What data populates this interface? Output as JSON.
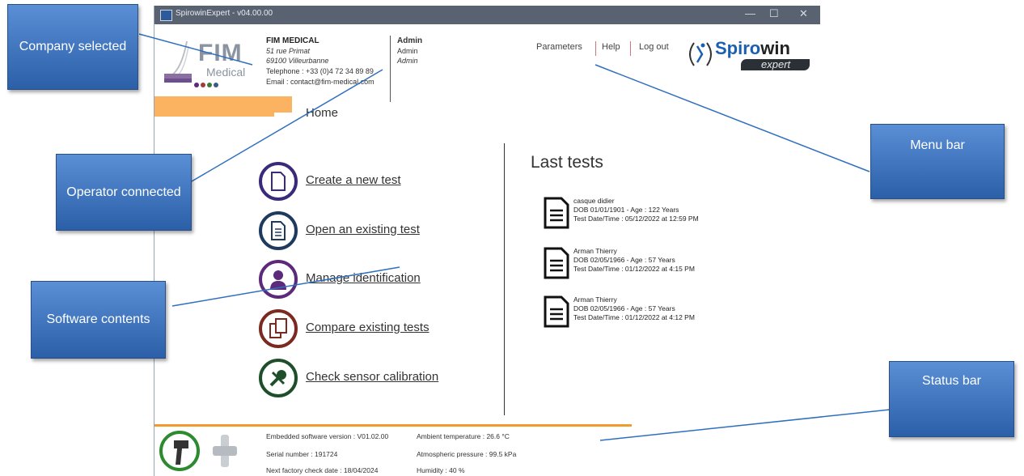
{
  "window": {
    "title": "SpirowinExpert - v04.00.00",
    "controls": [
      "—",
      "☐",
      "✕"
    ]
  },
  "company": {
    "logo_text": "FIM",
    "logo_sub": "Medical",
    "name": "FIM MEDICAL",
    "address1": "51 rue Primat",
    "address2": "69100 Villeurbanne",
    "phone": "Telephone : +33 (0)4 72 34 89 89",
    "email": "Email : contact@fim-medical.com"
  },
  "operator": {
    "title": "Admin",
    "line1": "Admin",
    "line2": "Admin"
  },
  "menu": {
    "parameters": "Parameters",
    "help": "Help",
    "logout": "Log out"
  },
  "brand": {
    "name_a": "Spiro",
    "name_b": "win",
    "sub": "expert"
  },
  "home_tab": "Home",
  "actions": [
    {
      "label": "Create a new test",
      "icon": "new-document-icon",
      "color": "#3b2a78"
    },
    {
      "label": "Open an existing test",
      "icon": "open-document-icon",
      "color": "#1e3a5f"
    },
    {
      "label": "Manage identification",
      "icon": "person-icon",
      "color": "#5b2a7a"
    },
    {
      "label": "Compare existing tests",
      "icon": "compare-icon",
      "color": "#7a2a20"
    },
    {
      "label": "Check sensor calibration",
      "icon": "wrench-icon",
      "color": "#1f4f2a"
    }
  ],
  "last_tests": {
    "title": "Last tests",
    "items": [
      {
        "name": "casque didier",
        "dob": "DOB 01/01/1901 - Age : 122 Years",
        "date": "Test Date/Time : 05/12/2022 at 12:59 PM"
      },
      {
        "name": "Arman Thierry",
        "dob": "DOB 02/05/1966 - Age : 57 Years",
        "date": "Test Date/Time : 01/12/2022 at 4:15 PM"
      },
      {
        "name": "Arman Thierry",
        "dob": "DOB 02/05/1966 - Age : 57 Years",
        "date": "Test Date/Time : 01/12/2022 at 4:12 PM"
      }
    ]
  },
  "status": {
    "embedded": "Embedded software version : V01.02.00",
    "serial": "Serial number : 191724",
    "next_check": "Next factory check date  : 18/04/2024",
    "ambient": "Ambient temperature : 26.6 °C",
    "pressure": "Atmospheric pressure : 99.5 kPa",
    "humidity": "Humidity : 40 %"
  },
  "callouts": {
    "company": "Company selected",
    "operator": "Operator connected",
    "software": "Software contents",
    "menu": "Menu bar",
    "status": "Status bar"
  }
}
